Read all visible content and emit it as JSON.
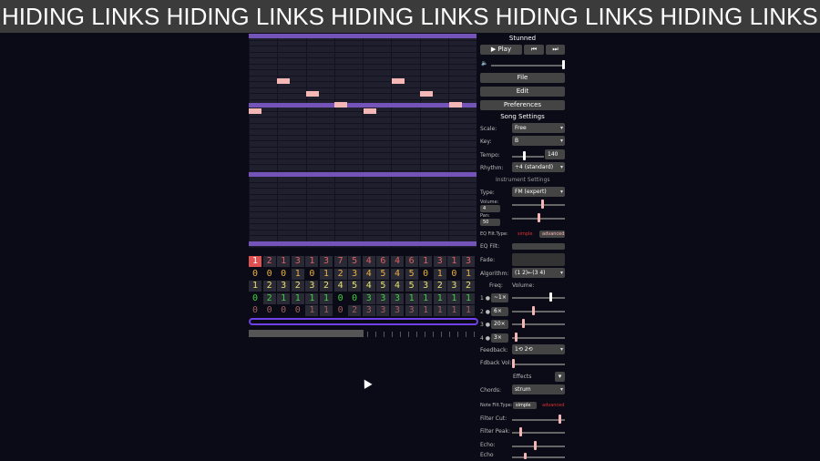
{
  "banner": {
    "text": "HIDING LINKS HIDING LINKS HIDING LINKS HIDING LINKS HIDING LINKS HIDING LINKS"
  },
  "song": {
    "title": "Stunned"
  },
  "transport": {
    "play_label": "Play",
    "play_icon": "▶",
    "prev_icon": "⏮",
    "next_icon": "⏭"
  },
  "menus": {
    "file": "File",
    "edit": "Edit",
    "preferences": "Preferences"
  },
  "song_settings": {
    "header": "Song Settings",
    "scale_label": "Scale:",
    "scale_value": "Free",
    "key_label": "Key:",
    "key_value": "B",
    "tempo_label": "Tempo:",
    "tempo_value": "140",
    "rhythm_label": "Rhythm:",
    "rhythm_value": "÷4 (standard)"
  },
  "instrument_settings": {
    "header": "Instrument Settings",
    "type_label": "Type:",
    "type_value": "FM (expert)",
    "volume_label": "Volume:",
    "volume_value": "4",
    "pan_label": "Pan:",
    "pan_value": "50",
    "eq_filt_type_label": "EQ Filt.Type:",
    "eq_simple": "simple",
    "eq_advanced": "advanced",
    "eq_filt_label": "EQ Filt:",
    "fade_label": "Fade:",
    "algorithm_label": "Algorithm:",
    "algorithm_value": "(1 2)←(3 4)",
    "freq_label": "Freq:",
    "volume_header": "Volume:",
    "operators": [
      {
        "num": "1",
        "freq": "~1×"
      },
      {
        "num": "2",
        "freq": "6×"
      },
      {
        "num": "3",
        "freq": "20×"
      },
      {
        "num": "4",
        "freq": "3×"
      }
    ],
    "feedback_label": "Feedback:",
    "feedback_value": "1⟲ 2⟲",
    "fdback_vol_label": "Fdback Vol:",
    "effects_label": "Effects",
    "chords_label": "Chords:",
    "chords_value": "strum",
    "note_filt_type_label": "Note Filt.Type:",
    "note_simple": "simple",
    "note_advanced": "advanced",
    "filter_cut_label": "Filter Cut:",
    "filter_peak_label": "Filter Peak:",
    "echo_label_1": "Echo:",
    "echo_label_2": "Echo"
  },
  "tracks": [
    {
      "color": "#e06060",
      "values": [
        "1",
        "2",
        "1",
        "3",
        "1",
        "3",
        "7",
        "5",
        "4",
        "6",
        "4",
        "6",
        "1",
        "3",
        "1",
        "3"
      ]
    },
    {
      "color": "#e8b040",
      "values": [
        "0",
        "0",
        "0",
        "1",
        "0",
        "1",
        "2",
        "3",
        "4",
        "5",
        "4",
        "5",
        "0",
        "1",
        "0",
        "1"
      ]
    },
    {
      "color": "#e8e070",
      "values": [
        "1",
        "2",
        "3",
        "2",
        "3",
        "2",
        "4",
        "5",
        "4",
        "5",
        "4",
        "5",
        "3",
        "2",
        "3",
        "2"
      ]
    },
    {
      "color": "#40d040",
      "values": [
        "0",
        "2",
        "1",
        "1",
        "1",
        "1",
        "0",
        "0",
        "3",
        "3",
        "3",
        "1",
        "1",
        "1",
        "1",
        "1"
      ]
    },
    {
      "color": "#a06060",
      "values": [
        "0",
        "0",
        "0",
        "0",
        "1",
        "1",
        "0",
        "2",
        "3",
        "3",
        "3",
        "3",
        "1",
        "1",
        "1",
        "1"
      ]
    }
  ],
  "accent_color": "#7454b8",
  "note_color": "#f5b6b6"
}
